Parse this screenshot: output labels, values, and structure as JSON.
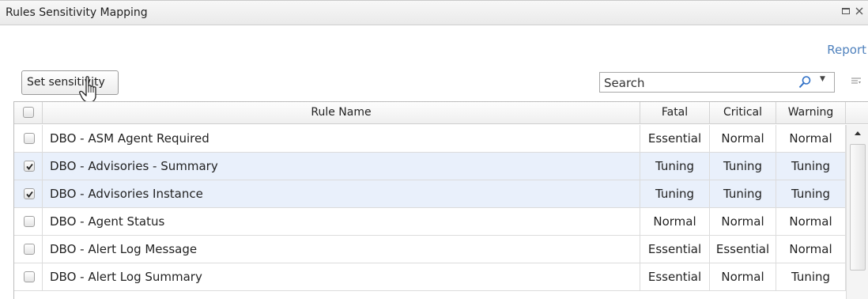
{
  "window": {
    "title": "Rules Sensitivity Mapping",
    "restore_icon": "restore-icon",
    "close_icon": "close-icon"
  },
  "toolbar": {
    "report_label": "Report",
    "set_sensitivity_label": "Set sensitivity",
    "search_placeholder": "Search"
  },
  "grid": {
    "columns": [
      "Rule Name",
      "Fatal",
      "Critical",
      "Warning"
    ],
    "rows": [
      {
        "checked": false,
        "name": "DBO - ASM Agent Required",
        "fatal": "Essential",
        "critical": "Normal",
        "warning": "Normal"
      },
      {
        "checked": true,
        "name": "DBO - Advisories - Summary",
        "fatal": "Tuning",
        "critical": "Tuning",
        "warning": "Tuning"
      },
      {
        "checked": true,
        "name": "DBO - Advisories Instance",
        "fatal": "Tuning",
        "critical": "Tuning",
        "warning": "Tuning"
      },
      {
        "checked": false,
        "name": "DBO - Agent Status",
        "fatal": "Normal",
        "critical": "Normal",
        "warning": "Normal"
      },
      {
        "checked": false,
        "name": "DBO - Alert Log Message",
        "fatal": "Essential",
        "critical": "Essential",
        "warning": "Normal"
      },
      {
        "checked": false,
        "name": "DBO - Alert Log Summary",
        "fatal": "Essential",
        "critical": "Normal",
        "warning": "Tuning"
      }
    ]
  },
  "colors": {
    "link": "#4f81bd",
    "selected_row": "#e9f0fb"
  }
}
